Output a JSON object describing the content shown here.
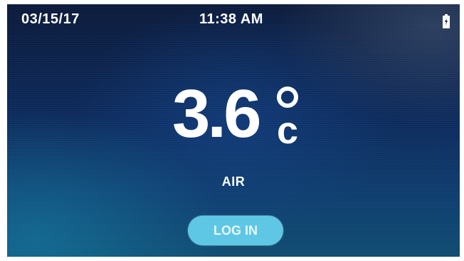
{
  "status_bar": {
    "date": "03/15/17",
    "time": "11:38 AM",
    "battery_icon": "battery-charging-icon"
  },
  "reading": {
    "value": "3.6",
    "unit_symbol": "°",
    "unit_letter": "c",
    "sensor_label": "AIR"
  },
  "actions": {
    "login_label": "LOG IN"
  },
  "colors": {
    "background_dark": "#0b1a3a",
    "background_mid": "#0e3d6e",
    "text": "#ffffff",
    "login_button": "#5cc6e4"
  }
}
